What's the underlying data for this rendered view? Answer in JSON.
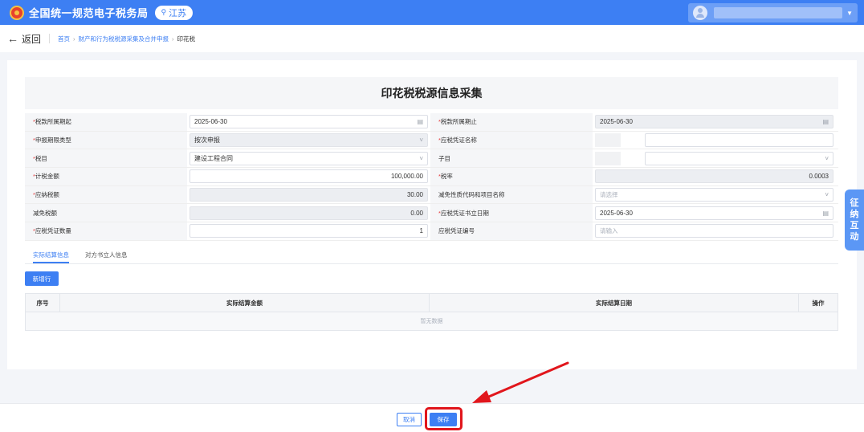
{
  "header": {
    "app_title": "全国统一规范电子税务局",
    "region": "江苏",
    "brand_color": "#3d7ff3"
  },
  "breadcrumb": {
    "back_label": "返回",
    "items": [
      "首页",
      "财产和行为税税源采集及合并申报",
      "印花税"
    ]
  },
  "form": {
    "title": "印花税税源信息采集",
    "rows": [
      {
        "l_label": "税款所属期起",
        "l_req": true,
        "l_value": "2025-06-30",
        "l_icon": "calendar-icon",
        "l_disabled": false,
        "r_label": "税款所属期止",
        "r_req": true,
        "r_value": "2025-06-30",
        "r_icon": "calendar-icon",
        "r_disabled": true
      },
      {
        "l_label": "申报期限类型",
        "l_req": true,
        "l_value": "按次申报",
        "l_icon": "chevron-down-icon",
        "l_disabled": true,
        "r_label": "应税凭证名称",
        "r_req": true,
        "r_value": "",
        "r_icon": "",
        "r_disabled": false
      },
      {
        "l_label": "税目",
        "l_req": true,
        "l_value": "建设工程合同",
        "l_icon": "chevron-down-icon",
        "l_disabled": false,
        "r_label": "子目",
        "r_req": false,
        "r_value": "",
        "r_icon": "chevron-down-icon",
        "r_disabled": false
      },
      {
        "l_label": "计税金额",
        "l_req": true,
        "l_value": "100,000.00",
        "l_icon": "",
        "l_disabled": false,
        "r_label": "税率",
        "r_req": true,
        "r_value": "0.0003",
        "r_icon": "",
        "r_disabled": true
      },
      {
        "l_label": "应纳税额",
        "l_req": true,
        "l_value": "30.00",
        "l_icon": "",
        "l_disabled": true,
        "r_label": "减免性质代码和项目名称",
        "r_req": false,
        "r_placeholder": "请选择",
        "r_icon": "chevron-down-icon",
        "r_disabled": false
      },
      {
        "l_label": "减免税额",
        "l_req": false,
        "l_value": "0.00",
        "l_icon": "",
        "l_disabled": true,
        "r_label": "应税凭证书立日期",
        "r_req": true,
        "r_value": "2025-06-30",
        "r_icon": "calendar-icon",
        "r_disabled": false
      },
      {
        "l_label": "应税凭证数量",
        "l_req": true,
        "l_value": "1",
        "l_icon": "",
        "l_disabled": false,
        "r_label": "应税凭证编号",
        "r_req": false,
        "r_placeholder": "请输入",
        "r_icon": "",
        "r_disabled": false
      }
    ]
  },
  "tabs": [
    "实际结算信息",
    "对方书立人信息"
  ],
  "add_row_label": "新增行",
  "table": {
    "columns": [
      "序号",
      "实际结算金额",
      "实际结算日期",
      "操作"
    ],
    "empty_text": "暂无数据"
  },
  "footer": {
    "cancel_label": "取消",
    "save_label": "保存"
  },
  "side_widget": "征纳互动",
  "annotation_color": "#e1161c"
}
